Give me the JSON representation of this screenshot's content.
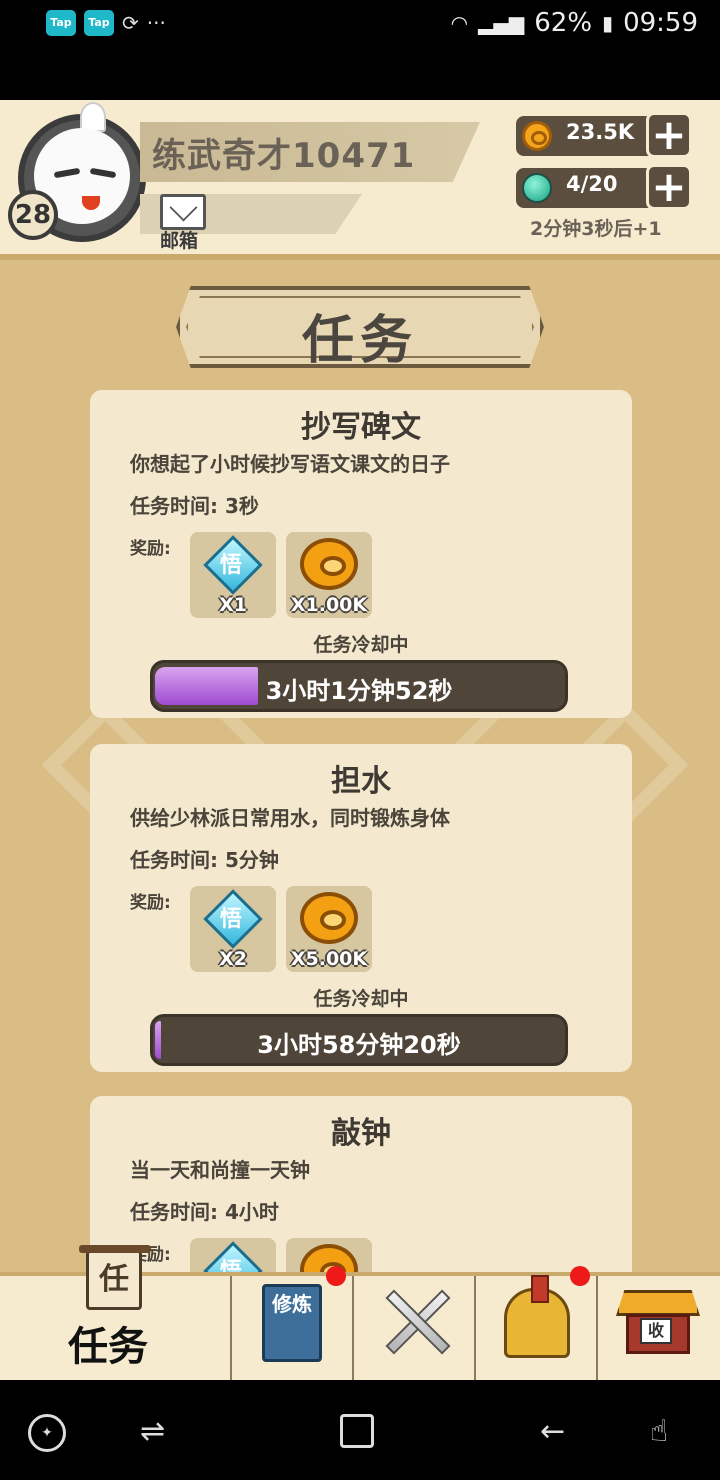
{
  "statusbar": {
    "tap_app_1": "Tap",
    "tap_app_2": "Tap",
    "more": "···",
    "battery": "62%",
    "time": "09:59"
  },
  "profile": {
    "level": "28",
    "name": "练武奇才10471",
    "mail_label": "邮箱"
  },
  "resources": {
    "coins": "23.5K",
    "stamina": "4/20",
    "stamina_timer": "2分钟3秒后+1",
    "plus": "+"
  },
  "page_title": "任务",
  "tasks": [
    {
      "title": "抄写碑文",
      "desc": "你想起了小时候抄写语文课文的日子",
      "time": "任务时间: 3秒",
      "reward_label": "奖励:",
      "reward_gem_qty": "X1",
      "reward_coin_qty": "X1.00K",
      "gem_glyph": "悟",
      "status": "任务冷却中",
      "countdown": "3小时1分钟52秒",
      "progress": 0.25
    },
    {
      "title": "担水",
      "desc": "供给少林派日常用水，同时锻炼身体",
      "time": "任务时间: 5分钟",
      "reward_label": "奖励:",
      "reward_gem_qty": "X2",
      "reward_coin_qty": "X5.00K",
      "gem_glyph": "悟",
      "status": "任务冷却中",
      "countdown": "3小时58分钟20秒",
      "progress": 0.01
    },
    {
      "title": "敲钟",
      "desc": "当一天和尚撞一天钟",
      "time": "任务时间: 4小时",
      "reward_label": "奖励:",
      "gem_glyph": "悟"
    }
  ],
  "tabs": {
    "task_scroll": "任",
    "task_label": "任务",
    "train_book": "修炼",
    "collect_sign": "收"
  }
}
